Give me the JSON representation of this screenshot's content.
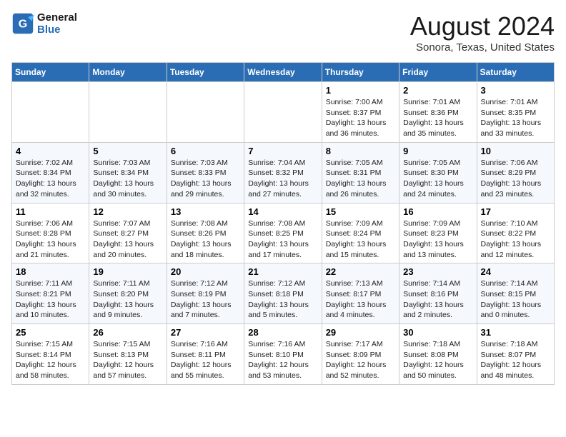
{
  "header": {
    "logo_line1": "General",
    "logo_line2": "Blue",
    "title": "August 2024",
    "subtitle": "Sonora, Texas, United States"
  },
  "weekdays": [
    "Sunday",
    "Monday",
    "Tuesday",
    "Wednesday",
    "Thursday",
    "Friday",
    "Saturday"
  ],
  "weeks": [
    [
      {
        "day": "",
        "info": ""
      },
      {
        "day": "",
        "info": ""
      },
      {
        "day": "",
        "info": ""
      },
      {
        "day": "",
        "info": ""
      },
      {
        "day": "1",
        "info": "Sunrise: 7:00 AM\nSunset: 8:37 PM\nDaylight: 13 hours\nand 36 minutes."
      },
      {
        "day": "2",
        "info": "Sunrise: 7:01 AM\nSunset: 8:36 PM\nDaylight: 13 hours\nand 35 minutes."
      },
      {
        "day": "3",
        "info": "Sunrise: 7:01 AM\nSunset: 8:35 PM\nDaylight: 13 hours\nand 33 minutes."
      }
    ],
    [
      {
        "day": "4",
        "info": "Sunrise: 7:02 AM\nSunset: 8:34 PM\nDaylight: 13 hours\nand 32 minutes."
      },
      {
        "day": "5",
        "info": "Sunrise: 7:03 AM\nSunset: 8:34 PM\nDaylight: 13 hours\nand 30 minutes."
      },
      {
        "day": "6",
        "info": "Sunrise: 7:03 AM\nSunset: 8:33 PM\nDaylight: 13 hours\nand 29 minutes."
      },
      {
        "day": "7",
        "info": "Sunrise: 7:04 AM\nSunset: 8:32 PM\nDaylight: 13 hours\nand 27 minutes."
      },
      {
        "day": "8",
        "info": "Sunrise: 7:05 AM\nSunset: 8:31 PM\nDaylight: 13 hours\nand 26 minutes."
      },
      {
        "day": "9",
        "info": "Sunrise: 7:05 AM\nSunset: 8:30 PM\nDaylight: 13 hours\nand 24 minutes."
      },
      {
        "day": "10",
        "info": "Sunrise: 7:06 AM\nSunset: 8:29 PM\nDaylight: 13 hours\nand 23 minutes."
      }
    ],
    [
      {
        "day": "11",
        "info": "Sunrise: 7:06 AM\nSunset: 8:28 PM\nDaylight: 13 hours\nand 21 minutes."
      },
      {
        "day": "12",
        "info": "Sunrise: 7:07 AM\nSunset: 8:27 PM\nDaylight: 13 hours\nand 20 minutes."
      },
      {
        "day": "13",
        "info": "Sunrise: 7:08 AM\nSunset: 8:26 PM\nDaylight: 13 hours\nand 18 minutes."
      },
      {
        "day": "14",
        "info": "Sunrise: 7:08 AM\nSunset: 8:25 PM\nDaylight: 13 hours\nand 17 minutes."
      },
      {
        "day": "15",
        "info": "Sunrise: 7:09 AM\nSunset: 8:24 PM\nDaylight: 13 hours\nand 15 minutes."
      },
      {
        "day": "16",
        "info": "Sunrise: 7:09 AM\nSunset: 8:23 PM\nDaylight: 13 hours\nand 13 minutes."
      },
      {
        "day": "17",
        "info": "Sunrise: 7:10 AM\nSunset: 8:22 PM\nDaylight: 13 hours\nand 12 minutes."
      }
    ],
    [
      {
        "day": "18",
        "info": "Sunrise: 7:11 AM\nSunset: 8:21 PM\nDaylight: 13 hours\nand 10 minutes."
      },
      {
        "day": "19",
        "info": "Sunrise: 7:11 AM\nSunset: 8:20 PM\nDaylight: 13 hours\nand 9 minutes."
      },
      {
        "day": "20",
        "info": "Sunrise: 7:12 AM\nSunset: 8:19 PM\nDaylight: 13 hours\nand 7 minutes."
      },
      {
        "day": "21",
        "info": "Sunrise: 7:12 AM\nSunset: 8:18 PM\nDaylight: 13 hours\nand 5 minutes."
      },
      {
        "day": "22",
        "info": "Sunrise: 7:13 AM\nSunset: 8:17 PM\nDaylight: 13 hours\nand 4 minutes."
      },
      {
        "day": "23",
        "info": "Sunrise: 7:14 AM\nSunset: 8:16 PM\nDaylight: 13 hours\nand 2 minutes."
      },
      {
        "day": "24",
        "info": "Sunrise: 7:14 AM\nSunset: 8:15 PM\nDaylight: 13 hours\nand 0 minutes."
      }
    ],
    [
      {
        "day": "25",
        "info": "Sunrise: 7:15 AM\nSunset: 8:14 PM\nDaylight: 12 hours\nand 58 minutes."
      },
      {
        "day": "26",
        "info": "Sunrise: 7:15 AM\nSunset: 8:13 PM\nDaylight: 12 hours\nand 57 minutes."
      },
      {
        "day": "27",
        "info": "Sunrise: 7:16 AM\nSunset: 8:11 PM\nDaylight: 12 hours\nand 55 minutes."
      },
      {
        "day": "28",
        "info": "Sunrise: 7:16 AM\nSunset: 8:10 PM\nDaylight: 12 hours\nand 53 minutes."
      },
      {
        "day": "29",
        "info": "Sunrise: 7:17 AM\nSunset: 8:09 PM\nDaylight: 12 hours\nand 52 minutes."
      },
      {
        "day": "30",
        "info": "Sunrise: 7:18 AM\nSunset: 8:08 PM\nDaylight: 12 hours\nand 50 minutes."
      },
      {
        "day": "31",
        "info": "Sunrise: 7:18 AM\nSunset: 8:07 PM\nDaylight: 12 hours\nand 48 minutes."
      }
    ]
  ]
}
